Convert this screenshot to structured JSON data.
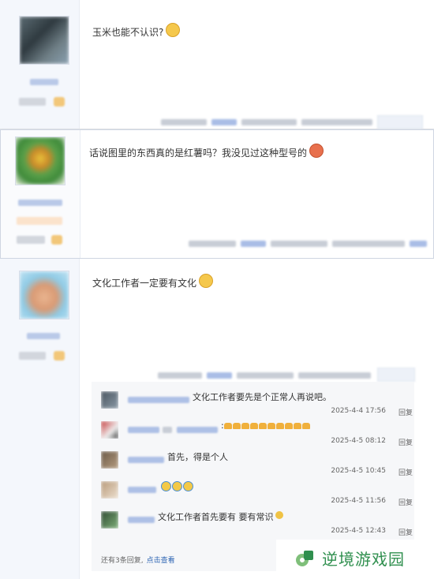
{
  "posts": [
    {
      "content": "玉米也能不认识?",
      "emoji": "smile-emoji"
    },
    {
      "content": "话说图里的东西真的是红薯吗？我没见过这种型号的",
      "emoji": "angry-emoji"
    },
    {
      "content": "文化工作者一定要有文化",
      "emoji": "smile-emoji",
      "sub_replies": [
        {
          "text": "文化工作者要先是个正常人再说吧。",
          "time": "2025-4-4 17:56",
          "reply": "回复"
        },
        {
          "text": "",
          "time": "2025-4-5 08:12",
          "reply": "回复"
        },
        {
          "text": "首先，得是个人",
          "time": "2025-4-5 10:45",
          "reply": "回复"
        },
        {
          "text": "",
          "time": "2025-4-5 11:56",
          "reply": "回复"
        },
        {
          "text": "文化工作者首先要有 要有常识",
          "time": "2025-4-5 12:43",
          "reply": "回复"
        }
      ],
      "more_text": "还有3条回复,",
      "more_link": "点击查看"
    }
  ],
  "watermark": {
    "text": "逆境游戏园",
    "color": "#2f8f4e"
  }
}
